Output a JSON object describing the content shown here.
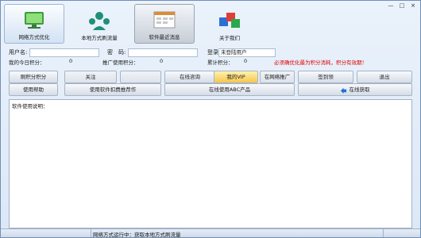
{
  "window": {
    "controls": [
      "—",
      "□",
      "×"
    ]
  },
  "toolbar": [
    {
      "label": "网络方式优化",
      "icon": "network-monitor-icon"
    },
    {
      "label": "本地方式刷流量",
      "icon": "local-people-icon"
    },
    {
      "label": "软件最近消息",
      "icon": "news-window-icon"
    },
    {
      "label": "关于我们",
      "icon": "about-cubes-icon"
    }
  ],
  "fields": {
    "user_label": "用户名:",
    "pwd_label": "密　码:",
    "login_label": "登录",
    "user_status": "未登陆用户"
  },
  "scores": {
    "today_label": "我的今日积分：",
    "today_value": "0",
    "promo_label": "推广使用积分：",
    "promo_value": "0",
    "total_label": "累计积分：",
    "total_value": "0",
    "notice": "必须确优化最为积分消耗，积分有效期！"
  },
  "buttons": {
    "b1": "刷积分积分",
    "b2": "使用帮助",
    "b3": "使用软件扣费推荐作",
    "b4": "关注",
    "b5": "在线咨询",
    "b6": "我的VIP",
    "b7": "在网络推广",
    "b8": "签到领",
    "b9": "退出",
    "b10": "在线使用ABC产品",
    "b11": "在线获取"
  },
  "info_label": "软件使用说明：",
  "status": "网络方式运行中：获取本地方式刷流量"
}
